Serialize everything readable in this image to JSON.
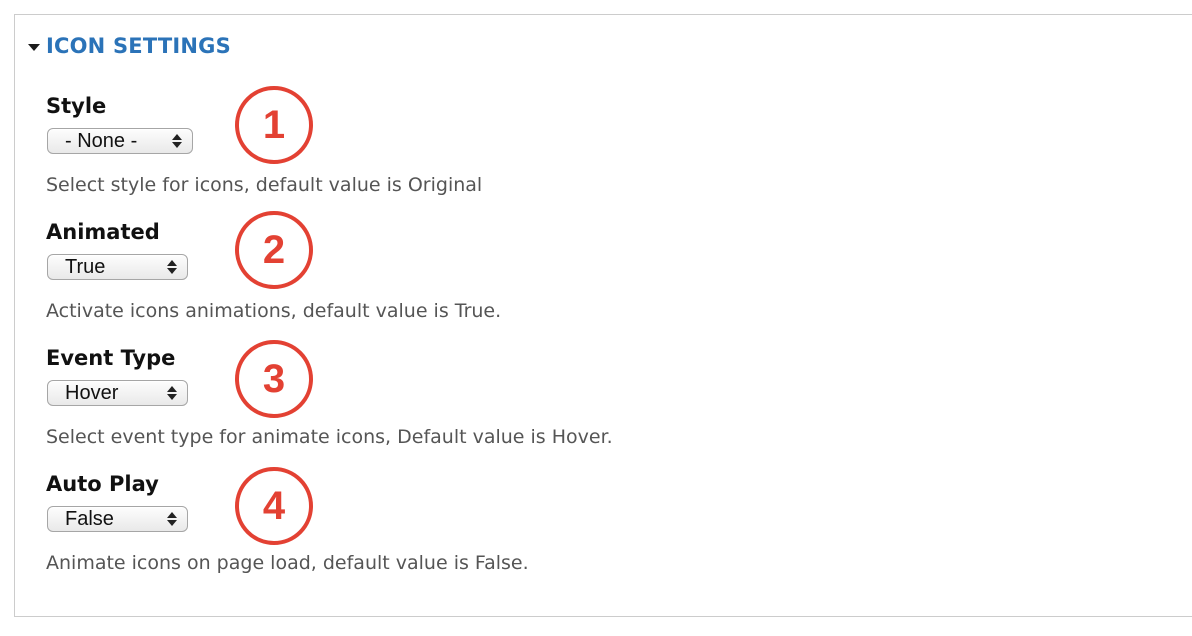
{
  "section": {
    "title": "ICON SETTINGS",
    "accent_color": "#2b73b8"
  },
  "fields": [
    {
      "label": "Style",
      "value": "- None -",
      "description": "Select style for icons, default value is Original",
      "badge": "1"
    },
    {
      "label": "Animated",
      "value": "True",
      "description": "Activate icons animations, default value is True.",
      "badge": "2"
    },
    {
      "label": "Event Type",
      "value": "Hover",
      "description": "Select event type for animate icons, Default value is Hover.",
      "badge": "3"
    },
    {
      "label": "Auto Play",
      "value": "False",
      "description": "Animate icons on page load, default value is False.",
      "badge": "4"
    }
  ],
  "annotation_color": "#e34133"
}
